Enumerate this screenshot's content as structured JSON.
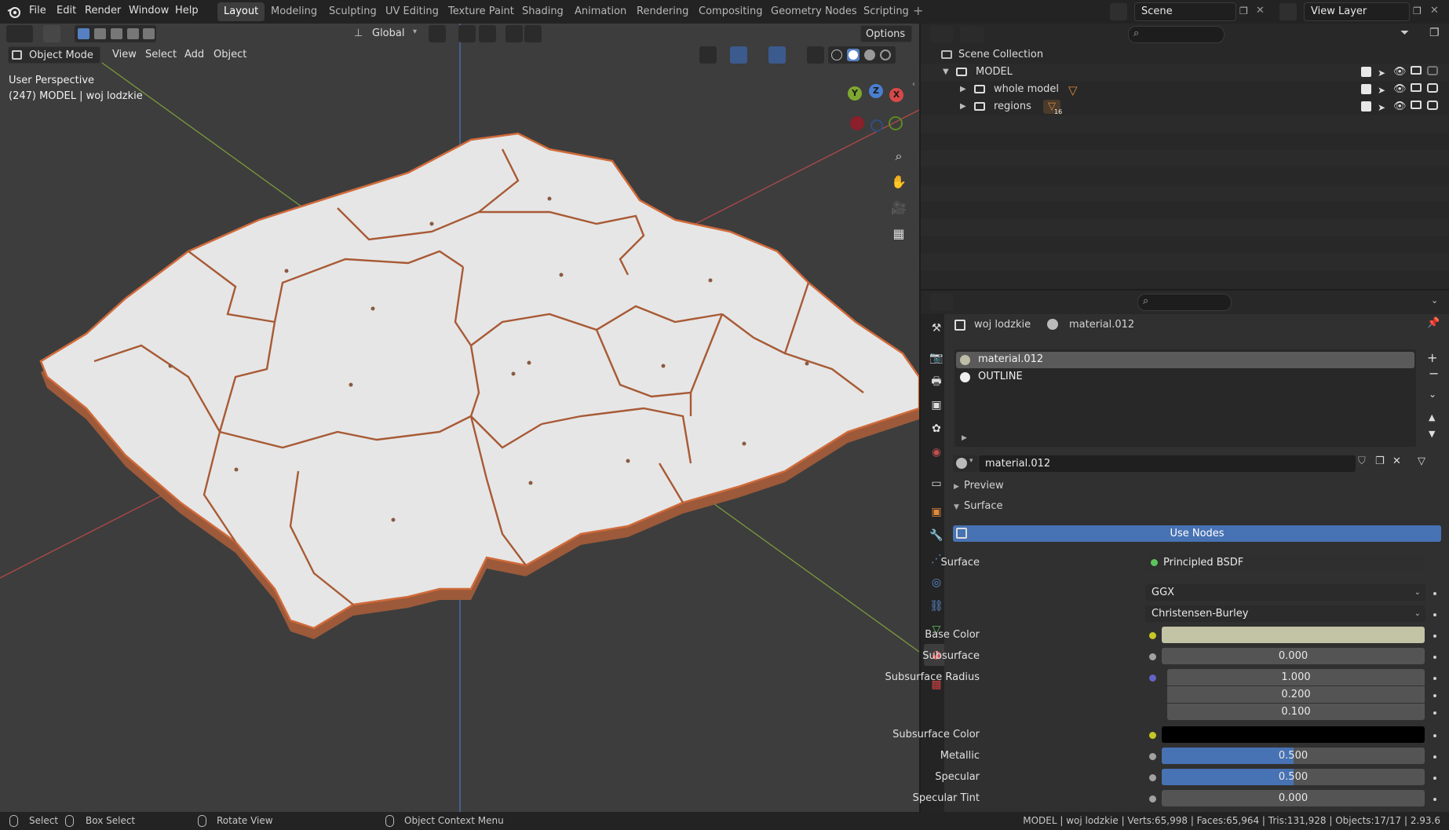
{
  "menu": {
    "items": [
      "File",
      "Edit",
      "Render",
      "Window",
      "Help"
    ]
  },
  "workspaces": {
    "tabs": [
      "Layout",
      "Modeling",
      "Sculpting",
      "UV Editing",
      "Texture Paint",
      "Shading",
      "Animation",
      "Rendering",
      "Compositing",
      "Geometry Nodes",
      "Scripting"
    ],
    "active": "Layout",
    "add": "+"
  },
  "scene": {
    "name": "Scene",
    "view_layer": "View Layer"
  },
  "viewport_header": {
    "transform_orientation": "Global",
    "options": "Options",
    "mode": "Object Mode",
    "menus": [
      "View",
      "Select",
      "Add",
      "Object"
    ]
  },
  "viewport_overlay": {
    "perspective": "User Perspective",
    "object_info": "(247) MODEL | woj lodzkie"
  },
  "gizmo": {
    "x": "X",
    "y": "Y",
    "z": "Z"
  },
  "outliner": {
    "root": "Scene Collection",
    "collection": "MODEL",
    "children": [
      "whole model",
      "regions"
    ],
    "regions_badge": "16"
  },
  "properties": {
    "breadcrumb_object": "woj lodzkie",
    "breadcrumb_material": "material.012",
    "slots": [
      "material.012",
      "OUTLINE"
    ],
    "material_name": "material.012",
    "panels": {
      "preview": "Preview",
      "surface": "Surface"
    },
    "use_nodes": "Use Nodes",
    "surface_label": "Surface",
    "surface_shader": "Principled BSDF",
    "distribution": "GGX",
    "subsurface_method": "Christensen-Burley",
    "rows": {
      "base_color": "Base Color",
      "subsurface": "Subsurface",
      "subsurface_value": "0.000",
      "subsurface_radius": "Subsurface Radius",
      "radius_values": [
        "1.000",
        "0.200",
        "0.100"
      ],
      "subsurface_color": "Subsurface Color",
      "metallic": "Metallic",
      "metallic_value": "0.500",
      "specular": "Specular",
      "specular_value": "0.500",
      "specular_tint": "Specular Tint",
      "specular_tint_value": "0.000"
    },
    "colors": {
      "base_color": "#c3c3a5",
      "subsurface_color": "#000000",
      "slider_fill": "#4772b3"
    },
    "metallic_fraction": 0.5,
    "specular_fraction": 0.5
  },
  "statusbar": {
    "select": "Select",
    "box_select": "Box Select",
    "rotate_view": "Rotate View",
    "context_menu": "Object Context Menu",
    "stats": "MODEL | woj lodzkie | Verts:65,998 | Faces:65,964 | Tris:131,928 | Objects:17/17 | 2.93.6"
  }
}
